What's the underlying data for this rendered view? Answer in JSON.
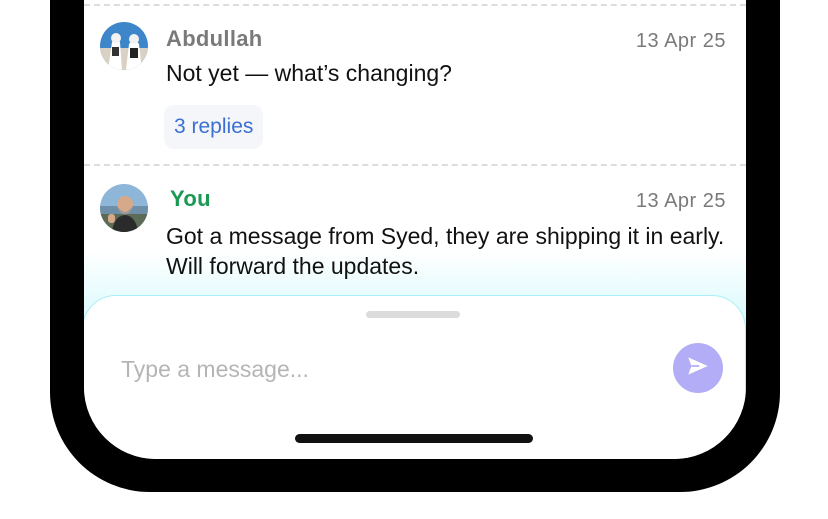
{
  "messages": [
    {
      "sender": "Abdullah",
      "timestamp": "13 Apr 25",
      "text": "Not yet — what’s changing?",
      "replies_label": "3 replies",
      "sender_color": "#7a7a7a"
    },
    {
      "sender": "You",
      "timestamp": "13 Apr 25",
      "text": "Got a message from Syed, they are shipping it in early. Will forward the updates.",
      "sender_color": "#1a9a55"
    }
  ],
  "composer": {
    "placeholder": "Type a message..."
  },
  "colors": {
    "accent_send": "#b3acf7",
    "link": "#3b6fd1",
    "composer_border": "#a9eef8"
  },
  "icons": {
    "send": "send-icon"
  }
}
